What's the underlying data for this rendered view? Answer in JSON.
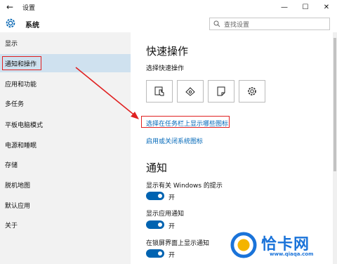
{
  "window": {
    "title": "设置"
  },
  "header": {
    "app_name": "系统",
    "search_placeholder": "查找设置"
  },
  "sidebar": {
    "items": [
      {
        "label": "显示"
      },
      {
        "label": "通知和操作"
      },
      {
        "label": "应用和功能"
      },
      {
        "label": "多任务"
      },
      {
        "label": "平板电脑模式"
      },
      {
        "label": "电源和睡眠"
      },
      {
        "label": "存储"
      },
      {
        "label": "脱机地图"
      },
      {
        "label": "默认应用"
      },
      {
        "label": "关于"
      }
    ]
  },
  "quick": {
    "title": "快速操作",
    "subtitle": "选择快速操作",
    "buttons": [
      {
        "icon": "tablet-mode-icon"
      },
      {
        "icon": "location-icon"
      },
      {
        "icon": "note-icon"
      },
      {
        "icon": "settings-gear-icon"
      }
    ],
    "link_taskbar": "选择在任务栏上显示哪些图标",
    "link_system_icons": "启用或关闭系统图标"
  },
  "notify": {
    "title": "通知",
    "items": [
      {
        "label": "显示有关 Windows 的提示",
        "state": "开"
      },
      {
        "label": "显示应用通知",
        "state": "开"
      },
      {
        "label": "在锁屏界面上显示通知",
        "state": "开"
      }
    ]
  },
  "watermark": {
    "name": "恰卡网",
    "url": "www.qiaqa.com"
  },
  "colors": {
    "accent": "#0063b1",
    "selected": "#cfe1ef",
    "highlight": "#e02020",
    "link": "#0067b8"
  }
}
